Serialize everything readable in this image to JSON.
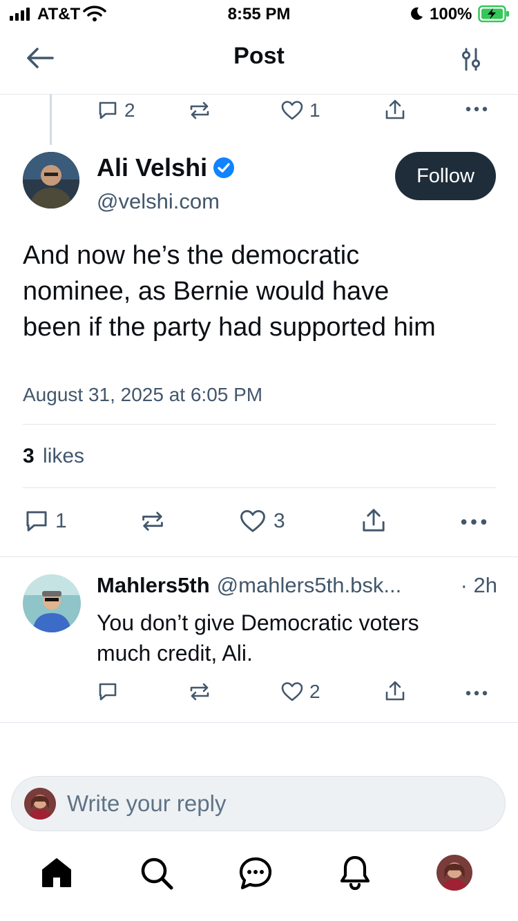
{
  "status_bar": {
    "carrier": "AT&T",
    "time": "8:55 PM",
    "battery": "100%"
  },
  "header": {
    "title": "Post",
    "back_icon": "arrow-left-icon",
    "settings_icon": "sliders-icon"
  },
  "parent_post_actions": {
    "replies": "2",
    "reposts": "",
    "likes": "1"
  },
  "post": {
    "author_name": "Ali Velshi",
    "handle": "@velshi.com",
    "verified": true,
    "follow_label": "Follow",
    "text_lines": [
      "And now he’s the democratic",
      "nominee, as Bernie would have",
      "been if the party had supported him"
    ],
    "timestamp": "August 31, 2025 at 6:05 PM",
    "likes_count": "3",
    "likes_label": "likes",
    "actions": {
      "replies": "1",
      "reposts": "",
      "likes": "3"
    }
  },
  "reply": {
    "author_name": "Mahlers5th",
    "handle": "@mahlers5th.bsk...",
    "time": "· 2h",
    "text_lines": [
      "You don’t give Democratic voters",
      "much credit, Ali."
    ],
    "actions": {
      "replies": "",
      "reposts": "",
      "likes": "2"
    }
  },
  "composer": {
    "placeholder": "Write your reply"
  },
  "tab_bar": [
    "home-icon",
    "search-icon",
    "chat-icon",
    "bell-icon",
    "profile-avatar"
  ],
  "colors": {
    "accent": "#1083fe",
    "follow_bg": "#1f2d3a",
    "muted": "#42576c",
    "battery": "#34c759"
  }
}
